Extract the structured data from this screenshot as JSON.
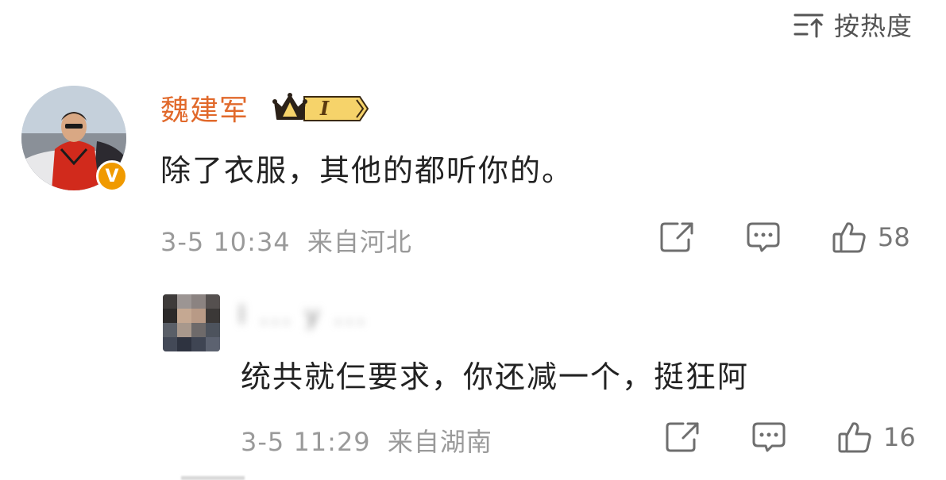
{
  "sort": {
    "label": "按热度",
    "icon": "sort-icon"
  },
  "comment": {
    "username": "魏建军",
    "badge_level": "I",
    "verified_mark": "V",
    "text": "除了衣服，其他的都听你的。",
    "time": "3-5 10:34",
    "location": "来自河北",
    "likes": "58",
    "icons": [
      "share-icon",
      "comment-icon",
      "like-icon"
    ]
  },
  "reply": {
    "username": "l ... y ... ",
    "text": "统共就仨要求，你还减一个，挺狂阿",
    "time": "3-5 11:29",
    "location": "来自湖南",
    "likes": "16"
  },
  "colors": {
    "username": "#e1692b",
    "text": "#222222",
    "meta": "#9a9a9a",
    "verified": "#f09a00",
    "crown": "#f2c94c"
  }
}
